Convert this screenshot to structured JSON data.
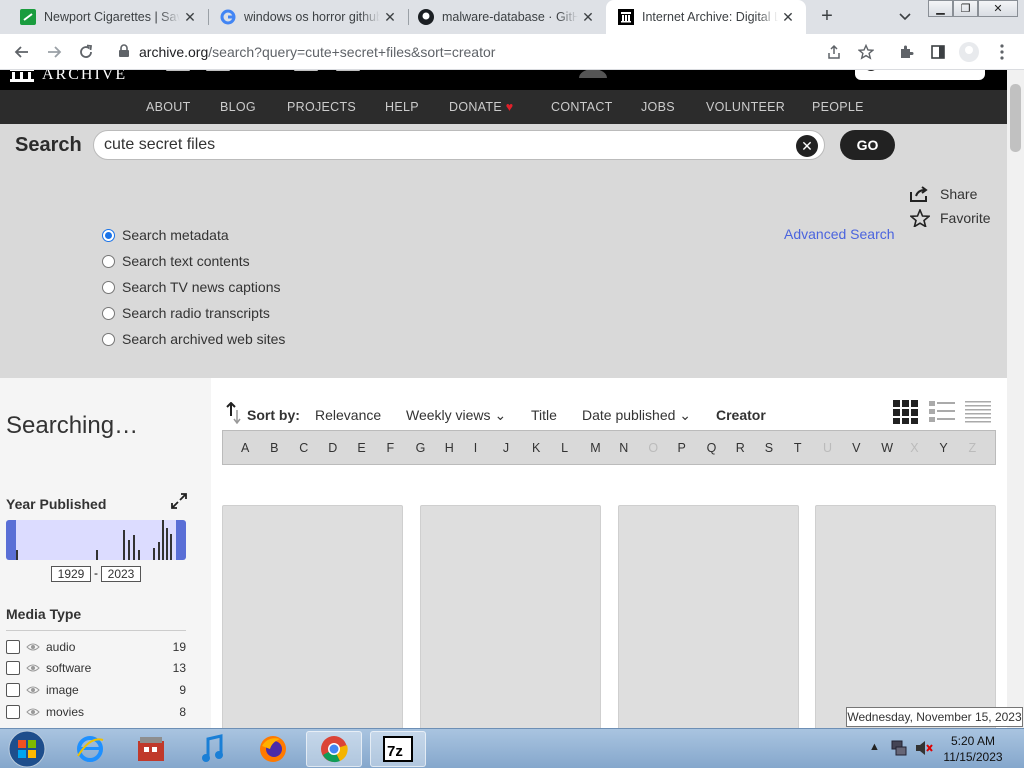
{
  "browser": {
    "tabs": [
      {
        "title": "Newport Cigarettes | Save",
        "icon": "newport-favicon"
      },
      {
        "title": "windows os horror github",
        "icon": "google-favicon"
      },
      {
        "title": "malware-database · GitHub",
        "icon": "github-favicon"
      },
      {
        "title": "Internet Archive: Digital Library",
        "icon": "archive-favicon",
        "active": true
      }
    ],
    "url_host": "archive.org",
    "url_path": "/search?query=cute+secret+files&sort=creator"
  },
  "ia_nav": [
    "ABOUT",
    "BLOG",
    "PROJECTS",
    "HELP",
    "DONATE",
    "CONTACT",
    "JOBS",
    "VOLUNTEER",
    "PEOPLE"
  ],
  "ia_logo_text": "ARCHIVE",
  "search": {
    "label": "Search",
    "query": "cute secret files",
    "go": "GO",
    "share": "Share",
    "favorite": "Favorite",
    "advanced": "Advanced Search",
    "options": [
      "Search metadata",
      "Search text contents",
      "Search TV news captions",
      "Search radio transcripts",
      "Search archived web sites"
    ],
    "selected_option": 0
  },
  "sidebar": {
    "status": "Searching…",
    "year_published": "Year Published",
    "year_from": "1929",
    "year_to": "2023",
    "media_type": "Media Type",
    "media": [
      {
        "label": "audio",
        "count": "19"
      },
      {
        "label": "software",
        "count": "13"
      },
      {
        "label": "image",
        "count": "9"
      },
      {
        "label": "movies",
        "count": "8"
      }
    ]
  },
  "sort": {
    "label": "Sort by:",
    "options": [
      "Relevance",
      "Weekly views",
      "Title",
      "Date published",
      "Creator"
    ],
    "active": "Creator"
  },
  "letters": [
    "A",
    "B",
    "C",
    "D",
    "E",
    "F",
    "G",
    "H",
    "I",
    "J",
    "K",
    "L",
    "M",
    "N",
    "O",
    "P",
    "Q",
    "R",
    "S",
    "T",
    "U",
    "V",
    "W",
    "X",
    "Y",
    "Z"
  ],
  "disabled_letters": [
    "O",
    "U",
    "X",
    "Z"
  ],
  "tooltip": "Wednesday, November 15, 2023",
  "clock": {
    "time": "5:20 AM",
    "date": "11/15/2023"
  },
  "colors": {
    "accent_blue": "#4b64de",
    "nav_bg": "#2c2c2c",
    "search_bg": "#d9d9d9",
    "donate_heart": "#e0202a"
  }
}
